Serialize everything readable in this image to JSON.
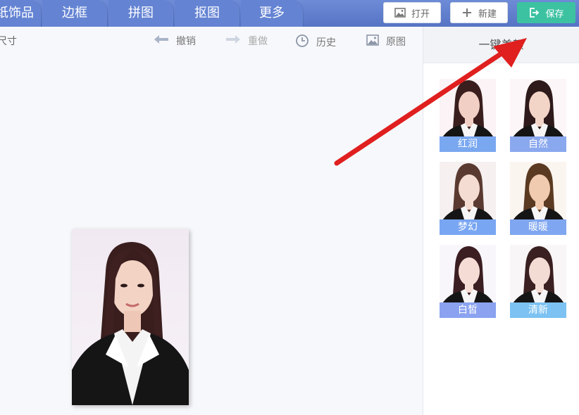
{
  "tabs": [
    {
      "label": "纸饰品"
    },
    {
      "label": "边框"
    },
    {
      "label": "拼图"
    },
    {
      "label": "抠图"
    },
    {
      "label": "更多"
    }
  ],
  "header_buttons": {
    "open": "打开",
    "new": "新建",
    "save": "保存"
  },
  "toolbar": {
    "size_label": "尺寸",
    "undo": "撤销",
    "redo": "重做",
    "history": "历史",
    "original": "原图"
  },
  "panel": {
    "title": "一键美颜",
    "filters": [
      {
        "label": "红润",
        "color": "#7aa8f0"
      },
      {
        "label": "自然",
        "color": "#8aa8ee"
      },
      {
        "label": "梦幻",
        "color": "#79a6f2"
      },
      {
        "label": "暖暖",
        "color": "#7fa6f0"
      },
      {
        "label": "白皙",
        "color": "#8aa2f0"
      },
      {
        "label": "清新",
        "color": "#7cc2f2"
      }
    ]
  },
  "colors": {
    "topbar": "#5f7ed0",
    "save": "#3cc2a1",
    "arrow": "#e01f1f"
  }
}
